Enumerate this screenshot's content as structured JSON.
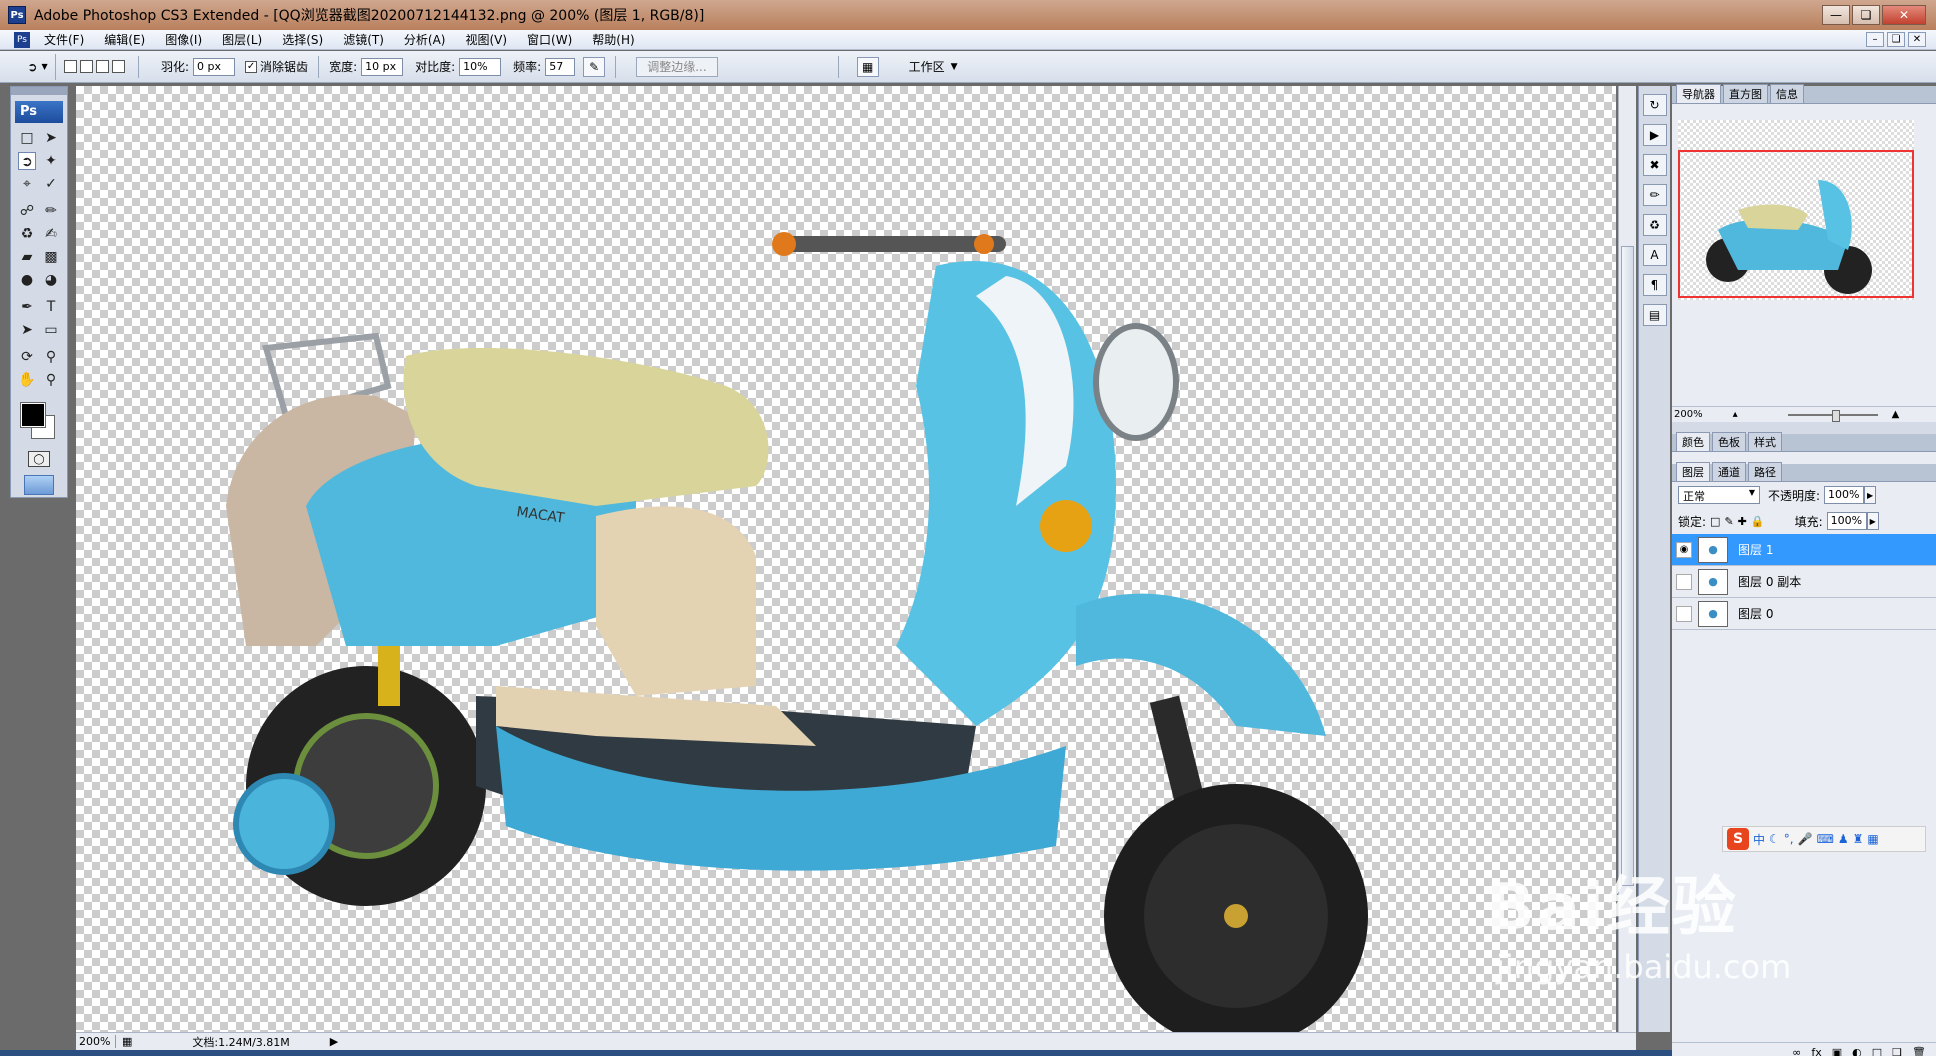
{
  "window": {
    "title": "Adobe Photoshop CS3 Extended - [QQ浏览器截图20200712144132.png @ 200% (图层 1, RGB/8)]",
    "icon": "ps-app-icon",
    "buttons": [
      "minimize",
      "restore",
      "close"
    ]
  },
  "menu": {
    "items": [
      "文件(F)",
      "编辑(E)",
      "图像(I)",
      "图层(L)",
      "选择(S)",
      "滤镜(T)",
      "分析(A)",
      "视图(V)",
      "窗口(W)",
      "帮助(H)"
    ]
  },
  "options": {
    "feather_label": "羽化:",
    "feather_value": "0 px",
    "antialias_label": "消除锯齿",
    "antialias_checked": true,
    "width_label": "宽度:",
    "width_value": "10 px",
    "contrast_label": "对比度:",
    "contrast_value": "10%",
    "frequency_label": "频率:",
    "frequency_value": "57",
    "refine_edge_label": "调整边缘...",
    "workspace_label": "工作区"
  },
  "toolbox": {
    "logo": "Ps",
    "tools": [
      "marquee-icon",
      "move-icon",
      "magnetic-lasso-icon",
      "magic-wand-icon",
      "crop-icon",
      "slice-icon",
      "healing-brush-icon",
      "brush-icon",
      "clone-stamp-icon",
      "history-brush-icon",
      "eraser-icon",
      "gradient-icon",
      "blur-icon",
      "dodge-icon",
      "pen-icon",
      "type-icon",
      "path-select-icon",
      "shape-icon",
      "3d-rotate-icon",
      "eyedropper-icon",
      "hand-icon",
      "zoom-icon"
    ],
    "foreground_color": "#000000",
    "background_color": "#ffffff"
  },
  "status": {
    "zoom": "200%",
    "doc_info": "文档:1.24M/3.81M"
  },
  "navigator": {
    "tabs": [
      "导航器",
      "直方图",
      "信息"
    ],
    "zoom": "200%"
  },
  "color_panel": {
    "tabs": [
      "颜色",
      "色板",
      "样式"
    ]
  },
  "layers_panel": {
    "tabs": [
      "图层",
      "通道",
      "路径"
    ],
    "blend_mode": "正常",
    "opacity_label": "不透明度:",
    "opacity_value": "100%",
    "lock_label": "锁定:",
    "fill_label": "填充:",
    "fill_value": "100%",
    "layers": [
      {
        "name": "图层 1",
        "visible": true,
        "selected": true
      },
      {
        "name": "图层 0 副本",
        "visible": false,
        "selected": false
      },
      {
        "name": "图层 0",
        "visible": false,
        "selected": false
      }
    ]
  },
  "ime": {
    "logo": "S",
    "label": "中"
  },
  "watermark": {
    "main": "Bai经验",
    "sub": "jingyan.baidu.com"
  },
  "colors": {
    "selection_blue": "#3399ff",
    "navigator_frame": "#ee3333"
  }
}
